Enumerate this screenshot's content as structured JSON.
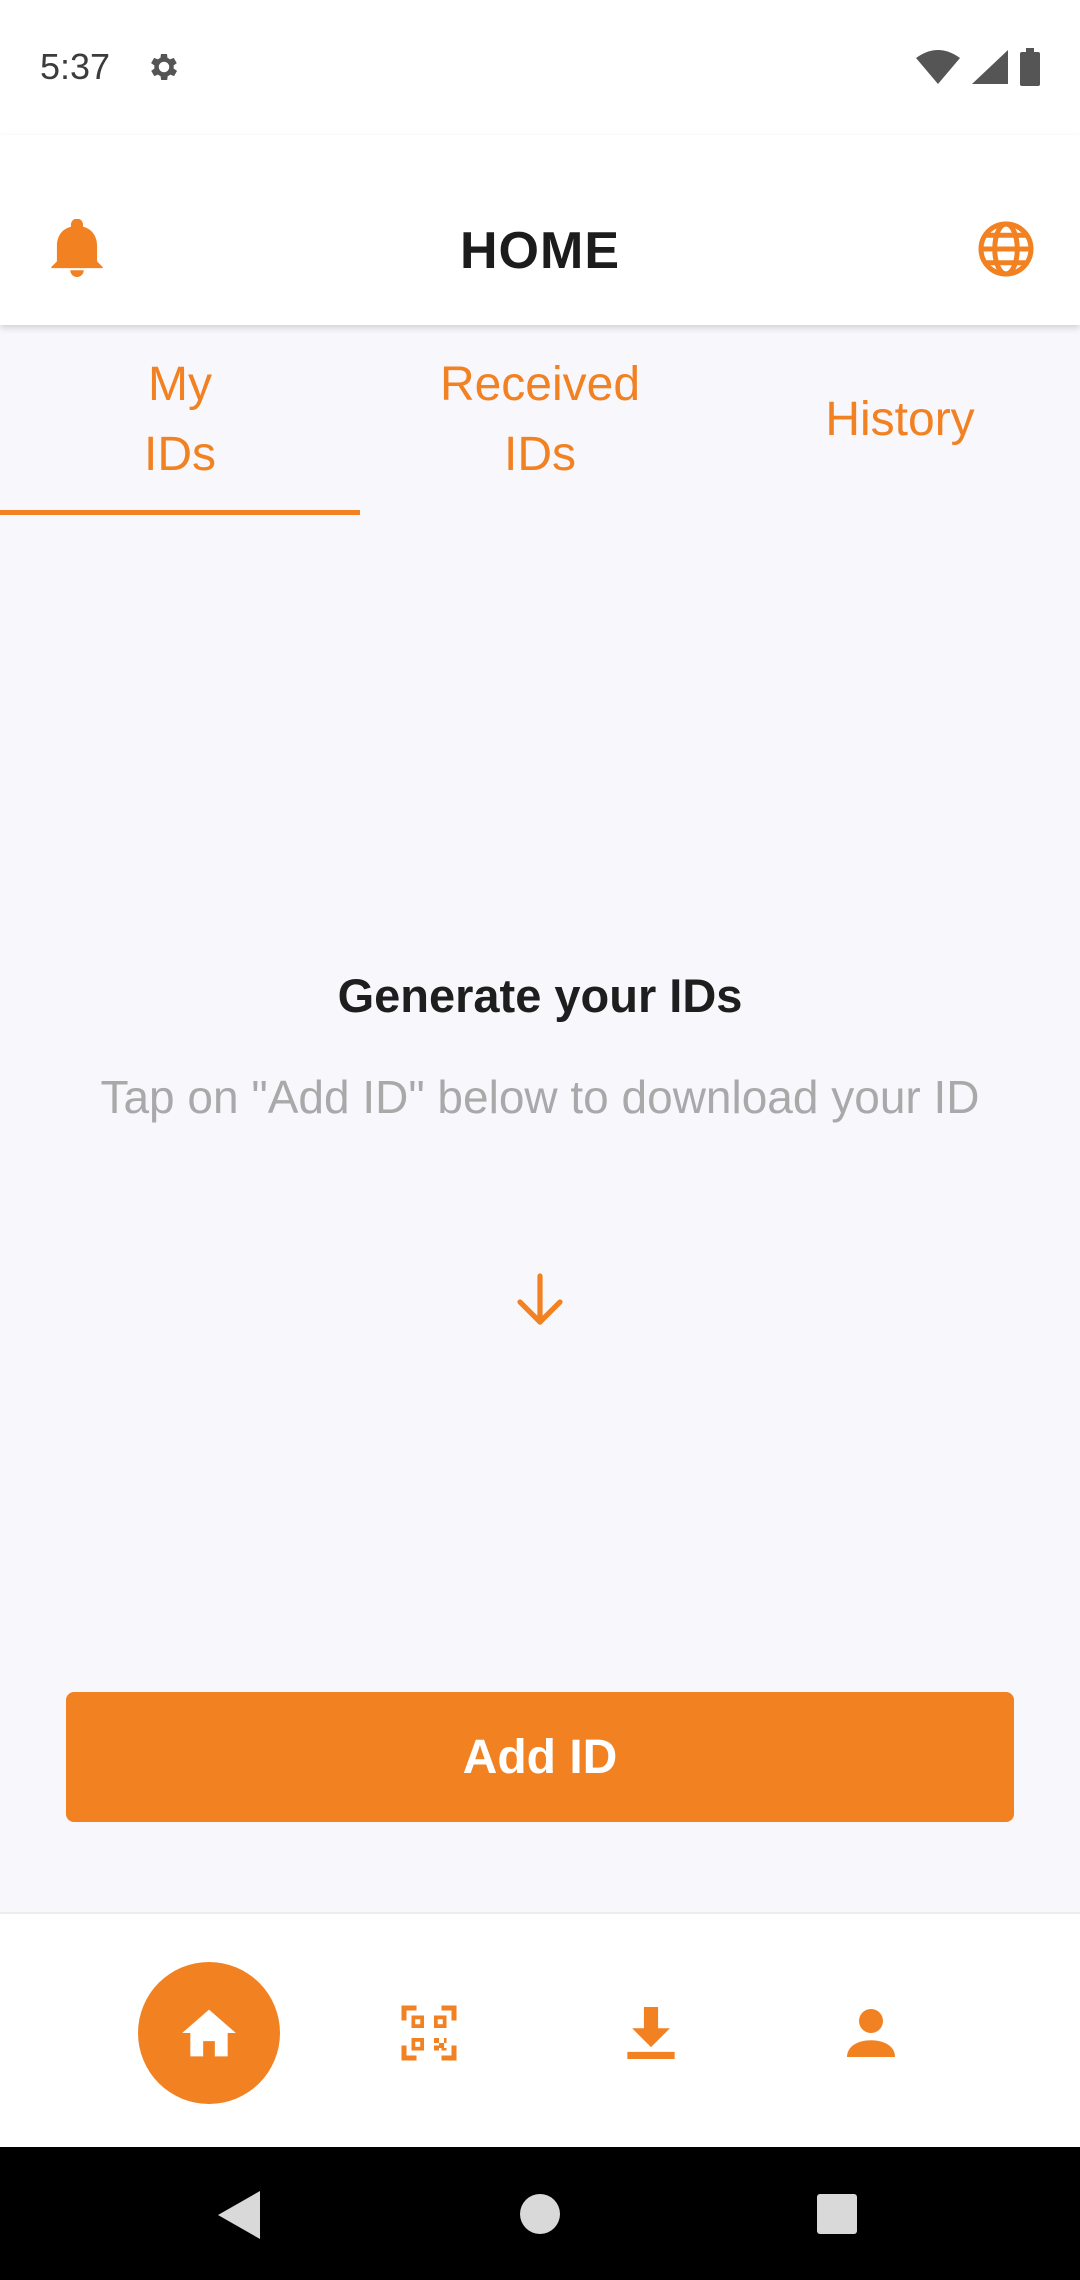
{
  "status_bar": {
    "time": "5:37"
  },
  "app_bar": {
    "title": "HOME"
  },
  "tabs": [
    {
      "label_line1": "My",
      "label_line2": "IDs"
    },
    {
      "label_line1": "Received",
      "label_line2": "IDs"
    },
    {
      "label_line1": "History"
    }
  ],
  "empty_state": {
    "title": "Generate your IDs",
    "description": "Tap on \"Add ID\" below to download your ID"
  },
  "add_button": {
    "label": "Add ID"
  },
  "colors": {
    "accent": "#f28122",
    "background": "#f8f7fc"
  },
  "bottom_nav": {
    "items": [
      "home-icon",
      "qr-code-icon",
      "download-icon",
      "profile-icon"
    ],
    "active": "home-icon"
  }
}
